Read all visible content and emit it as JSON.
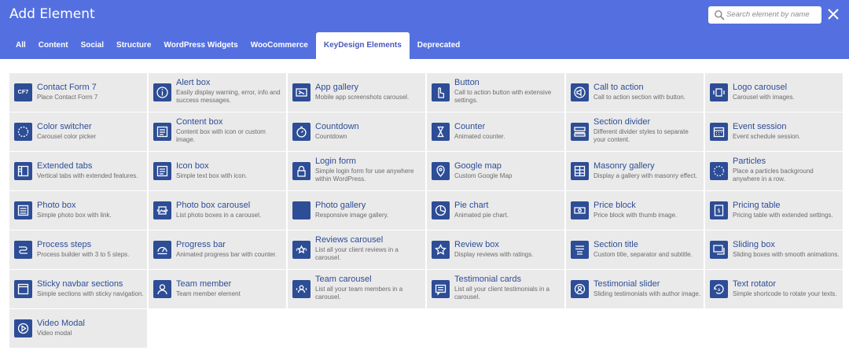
{
  "header": {
    "title": "Add Element",
    "search_placeholder": "Search element by name",
    "background": "#5470e0"
  },
  "tabs": [
    {
      "label": "All"
    },
    {
      "label": "Content"
    },
    {
      "label": "Social"
    },
    {
      "label": "Structure"
    },
    {
      "label": "WordPress Widgets"
    },
    {
      "label": "WooCommerce"
    },
    {
      "label": "KeyDesign Elements",
      "active": true
    },
    {
      "label": "Deprecated"
    }
  ],
  "elements": [
    {
      "name": "Contact Form 7",
      "desc": "Place Contact Form 7",
      "icon": "cf7-icon"
    },
    {
      "name": "Alert box",
      "desc": "Easily display warning, error, info and success messages.",
      "icon": "info-circle-icon"
    },
    {
      "name": "App gallery",
      "desc": "Mobile app screenshots carousel.",
      "icon": "app-gallery-icon"
    },
    {
      "name": "Button",
      "desc": "Call to action button with extensive settings.",
      "icon": "pointer-hand-icon"
    },
    {
      "name": "Call to action",
      "desc": "Call to action section with button.",
      "icon": "megaphone-icon"
    },
    {
      "name": "Logo carousel",
      "desc": "Carousel with images.",
      "icon": "carousel-icon"
    },
    {
      "name": "Color switcher",
      "desc": "Carousel color picker",
      "icon": "color-wheel-icon"
    },
    {
      "name": "Content box",
      "desc": "Content box with icon or custom image.",
      "icon": "content-box-icon"
    },
    {
      "name": "Countdown",
      "desc": "Countdown",
      "icon": "stopwatch-icon"
    },
    {
      "name": "Counter",
      "desc": "Animated counter.",
      "icon": "hourglass-icon"
    },
    {
      "name": "Section divider",
      "desc": "Different divider styles to separate your content.",
      "icon": "divider-icon"
    },
    {
      "name": "Event session",
      "desc": "Event schedule session.",
      "icon": "calendar-icon"
    },
    {
      "name": "Extended tabs",
      "desc": "Vertical tabs with extended features.",
      "icon": "tabs-icon"
    },
    {
      "name": "Icon box",
      "desc": "Simple text box with icon.",
      "icon": "icon-box-icon"
    },
    {
      "name": "Login form",
      "desc": "Simple login form for use anywhere within WordPress.",
      "icon": "lock-icon"
    },
    {
      "name": "Google map",
      "desc": "Custom Google Map",
      "icon": "map-pin-icon"
    },
    {
      "name": "Masonry gallery",
      "desc": "Display a gallery with masonry effect.",
      "icon": "masonry-icon"
    },
    {
      "name": "Particles",
      "desc": "Place a particles background anywhere in a row.",
      "icon": "particles-icon"
    },
    {
      "name": "Photo box",
      "desc": "Simple photo box with link.",
      "icon": "photo-box-icon"
    },
    {
      "name": "Photo box carousel",
      "desc": "List photo boxes in a carousel.",
      "icon": "photo-carousel-icon"
    },
    {
      "name": "Photo gallery",
      "desc": "Responsive image gallery.",
      "icon": "photo-gallery-icon"
    },
    {
      "name": "Pie chart",
      "desc": "Animated pie chart.",
      "icon": "pie-chart-icon"
    },
    {
      "name": "Price block",
      "desc": "Price block with thumb image.",
      "icon": "banknote-icon"
    },
    {
      "name": "Pricing table",
      "desc": "Pricing table with extended settings.",
      "icon": "pricing-table-icon"
    },
    {
      "name": "Process steps",
      "desc": "Process builder with 3 to 5 steps.",
      "icon": "process-steps-icon"
    },
    {
      "name": "Progress bar",
      "desc": "Animated progress bar with counter.",
      "icon": "progress-bar-icon"
    },
    {
      "name": "Reviews carousel",
      "desc": "List all your client reviews in a carousel.",
      "icon": "star-carousel-icon"
    },
    {
      "name": "Review box",
      "desc": "Display reviews with ratings.",
      "icon": "star-icon"
    },
    {
      "name": "Section title",
      "desc": "Custom title, separator and subtitle.",
      "icon": "section-title-icon"
    },
    {
      "name": "Sliding box",
      "desc": "Sliding boxes with smooth animations.",
      "icon": "sliding-box-icon"
    },
    {
      "name": "Sticky navbar sections",
      "desc": "Simple sections with sticky navigation.",
      "icon": "sticky-navbar-icon"
    },
    {
      "name": "Team member",
      "desc": "Team member element",
      "icon": "person-icon"
    },
    {
      "name": "Team carousel",
      "desc": "List all your team members in a carousel.",
      "icon": "team-carousel-icon"
    },
    {
      "name": "Testimonial cards",
      "desc": "List all your client testimonials in a carousel.",
      "icon": "testimonial-cards-icon"
    },
    {
      "name": "Testimonial slider",
      "desc": "Sliding testimonials with author image.",
      "icon": "testimonial-slider-icon"
    },
    {
      "name": "Text rotator",
      "desc": "Simple shortcode to rotate your texts.",
      "icon": "text-rotator-icon"
    },
    {
      "name": "Video Modal",
      "desc": "Video modal",
      "icon": "play-icon"
    }
  ]
}
